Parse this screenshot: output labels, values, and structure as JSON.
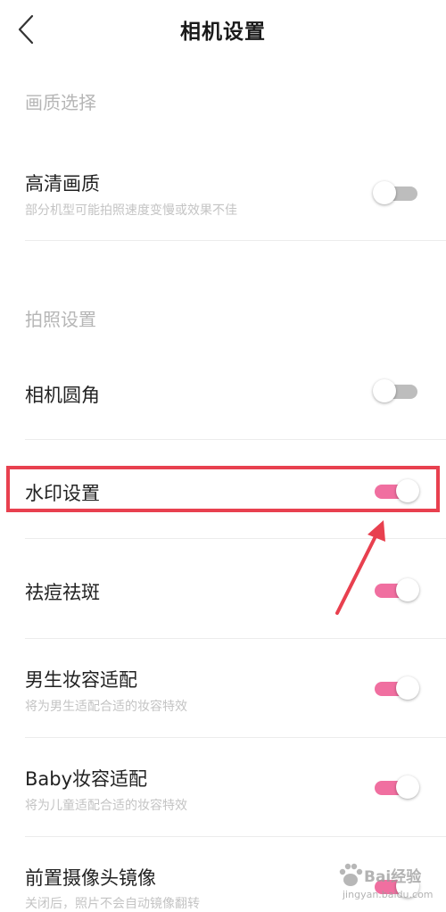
{
  "header": {
    "title": "相机设置",
    "back_icon": "chevron-left-icon"
  },
  "sections": {
    "quality": {
      "title": "画质选择"
    },
    "photo": {
      "title": "拍照设置"
    }
  },
  "rows": {
    "hd": {
      "label": "高清画质",
      "sub": "部分机型可能拍照速度变慢或效果不佳",
      "on": false
    },
    "rounded": {
      "label": "相机圆角",
      "on": false
    },
    "watermark": {
      "label": "水印设置",
      "on": true
    },
    "acne": {
      "label": "祛痘祛斑",
      "on": true
    },
    "male_makeup": {
      "label": "男生妆容适配",
      "sub": "将为男生适配合适的妆容特效",
      "on": true
    },
    "baby_makeup": {
      "label": "Baby妆容适配",
      "sub": "将为儿童适配合适的妆容特效",
      "on": true
    },
    "front_mirror": {
      "label": "前置摄像头镜像",
      "sub": "关闭后，照片不会自动镜像翻转",
      "on": true
    }
  },
  "annotation": {
    "highlight_color": "#e8404f"
  },
  "colors": {
    "accent": "#f06fa0",
    "toggle_off": "#bdbdbd"
  },
  "site_watermark": {
    "text": "Bai经验",
    "sub": "jingyan.baidu.com"
  }
}
